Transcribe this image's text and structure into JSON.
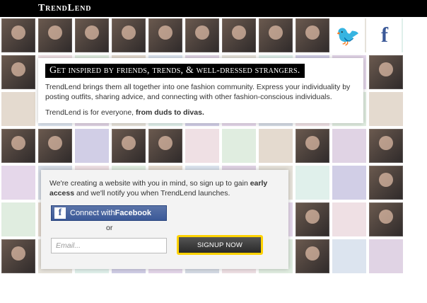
{
  "app": {
    "brand": "TrendLend"
  },
  "social": {
    "twitter_icon": "twitter-icon",
    "facebook_icon": "facebook-icon",
    "twitter_glyph": "🐦",
    "facebook_glyph": "f"
  },
  "intro": {
    "headline": "Get inspired by friends, trends, & well-dressed strangers.",
    "paragraph1": "TrendLend brings them all together into one fashion community. Express your individuality by posting outfits, sharing advice, and connecting with other fashion-conscious individuals.",
    "paragraph2_prefix": "TrendLend is for everyone, ",
    "paragraph2_bold": "from duds to divas."
  },
  "signup": {
    "text_prefix": "We're creating a website with you in mind, so sign up to gain ",
    "text_bold": "early access",
    "text_suffix": " and we'll notify you when TrendLend launches.",
    "facebook_button": {
      "connect_with": "Connect with ",
      "facebook_bold": "Facebook",
      "icon": "f"
    },
    "or": "or",
    "email_placeholder": "Email...",
    "signup_button": "Signup Now"
  },
  "colors": {
    "tiles": [
      "#cfe8e0",
      "#b9b3d8",
      "#d7c2df",
      "#bfc7d7",
      "#e6d0d6",
      "#cfe3cf",
      "#d6c6b6",
      "#c9d6e6",
      "#cfbcd6",
      "#d8d3c6"
    ]
  }
}
